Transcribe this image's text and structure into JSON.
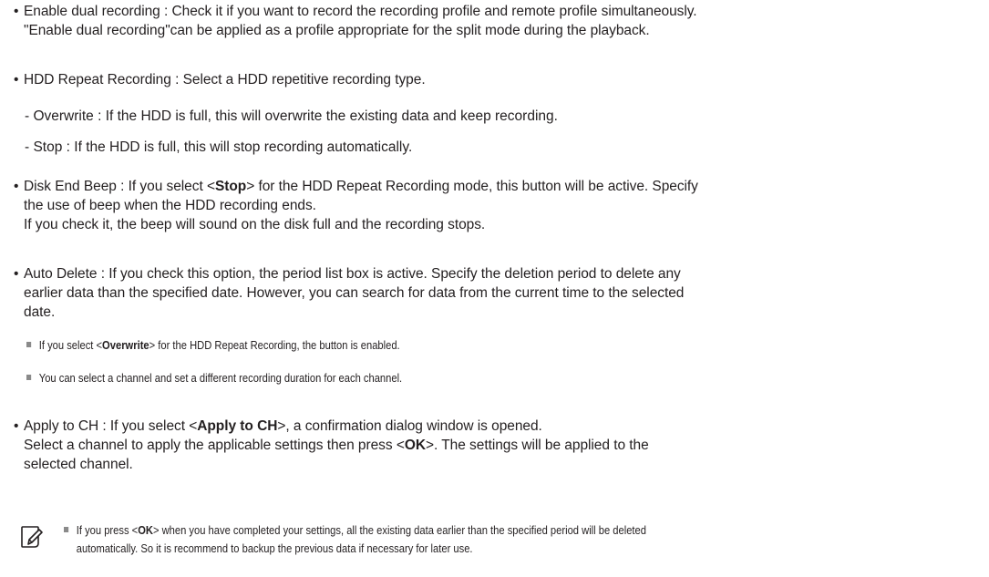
{
  "items": {
    "dual": {
      "bullet": "•",
      "line1": "Enable dual recording : Check it if you want to record the recording profile and remote profile simultaneously.",
      "line2": "\"Enable dual recording\"can be applied as a profile appropriate for the split mode during the playback."
    },
    "hdd": {
      "bullet": "•",
      "line1": "HDD Repeat Recording : Select a HDD repetitive recording type.",
      "sub1": "- Overwrite : If the HDD is full, this will overwrite the existing data and keep recording.",
      "sub2": "- Stop : If the HDD is full, this will stop recording automatically."
    },
    "beep": {
      "bullet": "•",
      "line1_pre": "Disk End Beep : If you select <",
      "line1_kw": "Stop",
      "line1_post": "> for the HDD Repeat Recording mode, this button will be active. Specify",
      "line2": "the use of beep when the HDD recording ends.",
      "line3": "If you check it, the beep will sound on the disk full and the recording stops."
    },
    "autodelete": {
      "bullet": "•",
      "line1": "Auto Delete : If you check this option, the period list box is active. Specify the deletion period to delete any",
      "line2": "earlier data than the specified date. However, you can search for data from the current time to the selected",
      "line3": "date.",
      "note1_pre": "If you select <",
      "note1_kw": "Overwrite",
      "note1_post": "> for the HDD Repeat Recording, the button is enabled.",
      "note2": "You can select a channel and set a different recording duration for each channel."
    },
    "applych": {
      "bullet": "•",
      "line1_pre": "Apply to CH : If you select <",
      "line1_kw": "Apply to CH",
      "line1_post": ">, a confirmation dialog window is opened.",
      "line2_pre": "Select a channel to apply the applicable settings then press <",
      "line2_kw": "OK",
      "line2_post": ">. The settings will be applied to the",
      "line3": "selected channel."
    }
  },
  "final_note": {
    "icon": "note-pencil-icon",
    "line1_pre": "If you press <",
    "line1_kw": "OK",
    "line1_post": "> when you have completed your settings, all the existing data earlier than the specified period will be deleted",
    "line2": "automatically. So it is recommend to backup the previous data if necessary for later use."
  },
  "colors": {
    "text": "#231f20",
    "note_square": "#8a8a8a"
  }
}
